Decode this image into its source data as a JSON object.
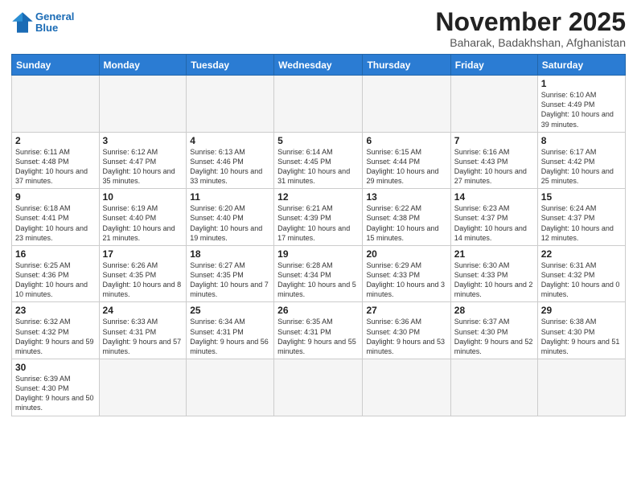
{
  "logo": {
    "line1": "General",
    "line2": "Blue"
  },
  "header": {
    "month": "November 2025",
    "location": "Baharak, Badakhshan, Afghanistan"
  },
  "weekdays": [
    "Sunday",
    "Monday",
    "Tuesday",
    "Wednesday",
    "Thursday",
    "Friday",
    "Saturday"
  ],
  "days": [
    {
      "date": null,
      "info": ""
    },
    {
      "date": null,
      "info": ""
    },
    {
      "date": null,
      "info": ""
    },
    {
      "date": null,
      "info": ""
    },
    {
      "date": null,
      "info": ""
    },
    {
      "date": null,
      "info": ""
    },
    {
      "date": "1",
      "info": "Sunrise: 6:10 AM\nSunset: 4:49 PM\nDaylight: 10 hours\nand 39 minutes."
    },
    {
      "date": "2",
      "info": "Sunrise: 6:11 AM\nSunset: 4:48 PM\nDaylight: 10 hours\nand 37 minutes."
    },
    {
      "date": "3",
      "info": "Sunrise: 6:12 AM\nSunset: 4:47 PM\nDaylight: 10 hours\nand 35 minutes."
    },
    {
      "date": "4",
      "info": "Sunrise: 6:13 AM\nSunset: 4:46 PM\nDaylight: 10 hours\nand 33 minutes."
    },
    {
      "date": "5",
      "info": "Sunrise: 6:14 AM\nSunset: 4:45 PM\nDaylight: 10 hours\nand 31 minutes."
    },
    {
      "date": "6",
      "info": "Sunrise: 6:15 AM\nSunset: 4:44 PM\nDaylight: 10 hours\nand 29 minutes."
    },
    {
      "date": "7",
      "info": "Sunrise: 6:16 AM\nSunset: 4:43 PM\nDaylight: 10 hours\nand 27 minutes."
    },
    {
      "date": "8",
      "info": "Sunrise: 6:17 AM\nSunset: 4:42 PM\nDaylight: 10 hours\nand 25 minutes."
    },
    {
      "date": "9",
      "info": "Sunrise: 6:18 AM\nSunset: 4:41 PM\nDaylight: 10 hours\nand 23 minutes."
    },
    {
      "date": "10",
      "info": "Sunrise: 6:19 AM\nSunset: 4:40 PM\nDaylight: 10 hours\nand 21 minutes."
    },
    {
      "date": "11",
      "info": "Sunrise: 6:20 AM\nSunset: 4:40 PM\nDaylight: 10 hours\nand 19 minutes."
    },
    {
      "date": "12",
      "info": "Sunrise: 6:21 AM\nSunset: 4:39 PM\nDaylight: 10 hours\nand 17 minutes."
    },
    {
      "date": "13",
      "info": "Sunrise: 6:22 AM\nSunset: 4:38 PM\nDaylight: 10 hours\nand 15 minutes."
    },
    {
      "date": "14",
      "info": "Sunrise: 6:23 AM\nSunset: 4:37 PM\nDaylight: 10 hours\nand 14 minutes."
    },
    {
      "date": "15",
      "info": "Sunrise: 6:24 AM\nSunset: 4:37 PM\nDaylight: 10 hours\nand 12 minutes."
    },
    {
      "date": "16",
      "info": "Sunrise: 6:25 AM\nSunset: 4:36 PM\nDaylight: 10 hours\nand 10 minutes."
    },
    {
      "date": "17",
      "info": "Sunrise: 6:26 AM\nSunset: 4:35 PM\nDaylight: 10 hours\nand 8 minutes."
    },
    {
      "date": "18",
      "info": "Sunrise: 6:27 AM\nSunset: 4:35 PM\nDaylight: 10 hours\nand 7 minutes."
    },
    {
      "date": "19",
      "info": "Sunrise: 6:28 AM\nSunset: 4:34 PM\nDaylight: 10 hours\nand 5 minutes."
    },
    {
      "date": "20",
      "info": "Sunrise: 6:29 AM\nSunset: 4:33 PM\nDaylight: 10 hours\nand 3 minutes."
    },
    {
      "date": "21",
      "info": "Sunrise: 6:30 AM\nSunset: 4:33 PM\nDaylight: 10 hours\nand 2 minutes."
    },
    {
      "date": "22",
      "info": "Sunrise: 6:31 AM\nSunset: 4:32 PM\nDaylight: 10 hours\nand 0 minutes."
    },
    {
      "date": "23",
      "info": "Sunrise: 6:32 AM\nSunset: 4:32 PM\nDaylight: 9 hours\nand 59 minutes."
    },
    {
      "date": "24",
      "info": "Sunrise: 6:33 AM\nSunset: 4:31 PM\nDaylight: 9 hours\nand 57 minutes."
    },
    {
      "date": "25",
      "info": "Sunrise: 6:34 AM\nSunset: 4:31 PM\nDaylight: 9 hours\nand 56 minutes."
    },
    {
      "date": "26",
      "info": "Sunrise: 6:35 AM\nSunset: 4:31 PM\nDaylight: 9 hours\nand 55 minutes."
    },
    {
      "date": "27",
      "info": "Sunrise: 6:36 AM\nSunset: 4:30 PM\nDaylight: 9 hours\nand 53 minutes."
    },
    {
      "date": "28",
      "info": "Sunrise: 6:37 AM\nSunset: 4:30 PM\nDaylight: 9 hours\nand 52 minutes."
    },
    {
      "date": "29",
      "info": "Sunrise: 6:38 AM\nSunset: 4:30 PM\nDaylight: 9 hours\nand 51 minutes."
    },
    {
      "date": "30",
      "info": "Sunrise: 6:39 AM\nSunset: 4:30 PM\nDaylight: 9 hours\nand 50 minutes."
    },
    {
      "date": null,
      "info": ""
    },
    {
      "date": null,
      "info": ""
    },
    {
      "date": null,
      "info": ""
    },
    {
      "date": null,
      "info": ""
    },
    {
      "date": null,
      "info": ""
    },
    {
      "date": null,
      "info": ""
    }
  ]
}
